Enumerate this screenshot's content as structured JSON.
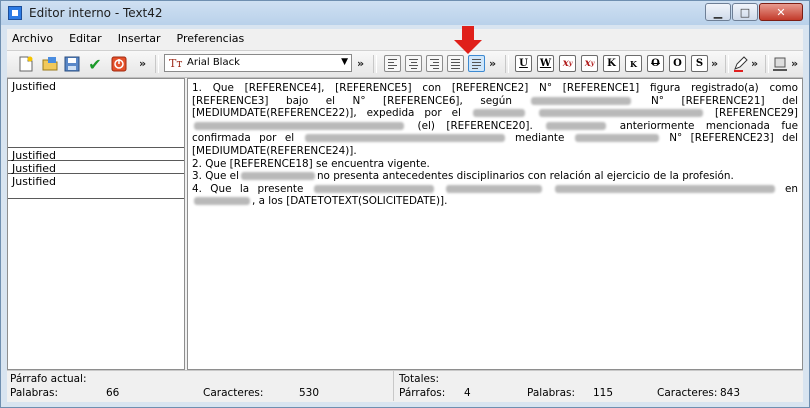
{
  "window": {
    "title": "Editor interno - Text42"
  },
  "menu": [
    "Archivo",
    "Editar",
    "Insertar",
    "Preferencias"
  ],
  "toolbar": {
    "font_name": "Arial Black",
    "more": "»"
  },
  "left_panel": {
    "rows": [
      "Justified",
      "Justified",
      "Justified",
      "Justified"
    ]
  },
  "document": {
    "p1": {
      "a": "1. Que [REFERENCE4], [REFERENCE5] con [REFERENCE2] N° [REFERENCE1] figura registrado(a) como [REFERENCE3] bajo el N° [REFERENCE6], según",
      "b": "N° [REFERENCE21] del [MEDIUMDATE(REFERENCE22)], expedida por el",
      "c": "[REFERENCE29]",
      "d": "(el) [REFERENCE20].",
      "e": "anteriormente mencionada fue confirmada por el",
      "f": "mediante",
      "g": "N° [REFERENCE23] del [MEDIUMDATE(REFERENCE24)]."
    },
    "p2": "2. Que [REFERENCE18] se encuentra vigente.",
    "p3": {
      "a": "3. Que el",
      "b": "no presenta antecedentes disciplinarios con relación al ejercicio de la profesión."
    },
    "p4": {
      "a": "4. Que la presente",
      "b": "en",
      "c": ", a los [DATETOTEXT(SOLICITEDATE)]."
    }
  },
  "status": {
    "current_paragraph_label": "Párrafo actual:",
    "words_label": "Palabras:",
    "words_value": "66",
    "chars_label": "Caracteres:",
    "chars_value": "530",
    "totals_label": "Totales:",
    "paragraphs_label": "Párrafos:",
    "paragraphs_value": "4",
    "total_words_label": "Palabras:",
    "total_words_value": "115",
    "total_chars_label": "Caracteres:",
    "total_chars_value": "843"
  }
}
